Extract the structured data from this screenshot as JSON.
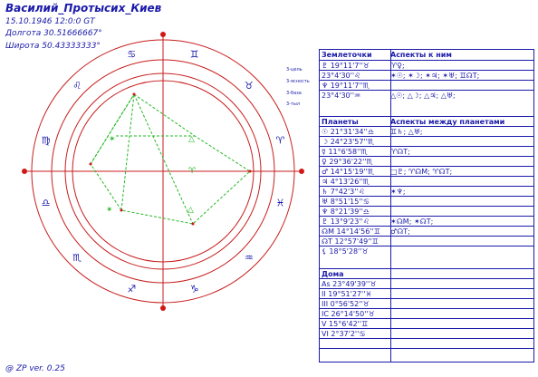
{
  "header": {
    "title": "Василий_Протысих_Киев",
    "datetime": "15.10.1946 12:0:0 GT",
    "longitude": "Долгота 30.51666667°",
    "latitude": "Широта 50.43333333°"
  },
  "legend": [
    "3-цель",
    "3-ясность",
    "3-база",
    "3-тыл"
  ],
  "footer": "@ ZP  ver. 0.25",
  "sections": {
    "earth": {
      "col1": "Землеточки",
      "col2": "Аспекты к ним",
      "rows": [
        {
          "a": "♇ 19°11'7''♉",
          "b": "♈♀;"
        },
        {
          "a": "23°4'30''♌",
          "b": "✶☉; ✶☽; ✶♃; ✶♅; ♊☊T;"
        },
        {
          "a": "♆ 19°11'7''♏",
          "b": ""
        },
        {
          "a": "23°4'30''♒",
          "b": "△☉; △☽; △♃; △♅;"
        }
      ]
    },
    "planets": {
      "col1": "Планеты",
      "col2": "Аспекты между планетами",
      "rows": [
        {
          "a": "☉ 21°31'34''♎",
          "b": "♊♄; △♅;"
        },
        {
          "a": "☽ 24°23'57''♏",
          "b": ""
        },
        {
          "a": "☿ 11°6'58''♏",
          "b": "♈☊T;"
        },
        {
          "a": "♀ 29°36'22''♏",
          "b": ""
        },
        {
          "a": "♂ 14°15'19''♏",
          "b": "□♇; ♈☊M; ♈☊T;"
        },
        {
          "a": "♃ 4°13'26''♏",
          "b": ""
        },
        {
          "a": "♄ 7°42'3''♌",
          "b": "✶♆;"
        },
        {
          "a": "♅ 8°51'15''♋",
          "b": ""
        },
        {
          "a": "♆ 8°21'39''♎",
          "b": ""
        },
        {
          "a": "♇ 13°9'23''♌",
          "b": "✶☊M; ✶☊T;"
        },
        {
          "a": "☊M 14°14'56''♊",
          "b": "♂☊T;"
        },
        {
          "a": "☊T 12°57'49''♊",
          "b": ""
        },
        {
          "a": "⚸ 18°5'28''♉",
          "b": ""
        }
      ]
    },
    "houses": {
      "col1": "Дома",
      "rows": [
        {
          "a": "As 23°49'39''♉",
          "b": ""
        },
        {
          "a": "II 19°51'27''♓",
          "b": ""
        },
        {
          "a": "III 0°56'52''♉",
          "b": ""
        },
        {
          "a": "IC 26°14'50''♉",
          "b": ""
        },
        {
          "a": "V 15°6'42''♊",
          "b": ""
        },
        {
          "a": "VI 2°37'2''♋",
          "b": ""
        }
      ]
    }
  },
  "chart_signs": [
    "♊",
    "♉",
    "♈",
    "♓",
    "♒",
    "♑",
    "♐",
    "♏",
    "♎",
    "♍",
    "♌",
    "♋"
  ],
  "colors": {
    "text": "#1a1aaa",
    "ring": "#c81e1e",
    "aspect": "#22b822",
    "marker": "#d01818"
  }
}
